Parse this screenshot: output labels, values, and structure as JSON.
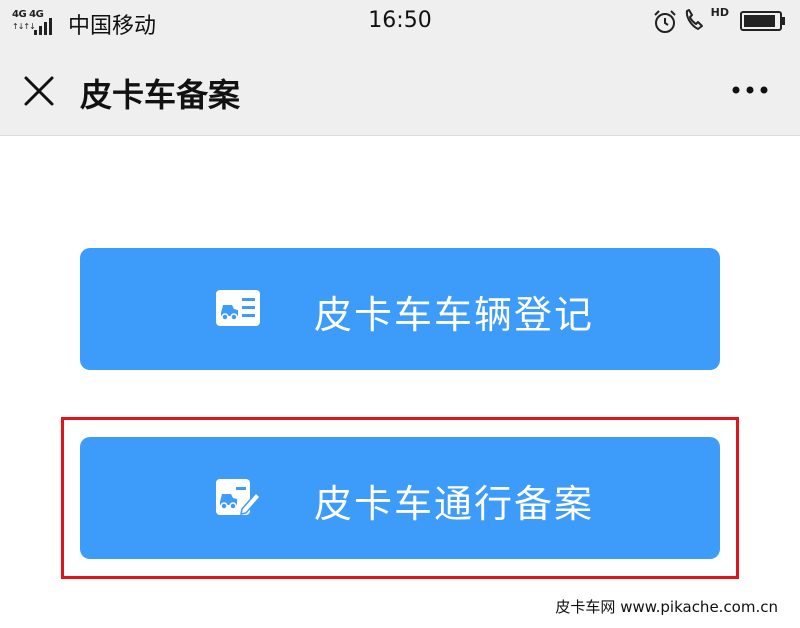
{
  "status_bar": {
    "network_label": "4G 4G",
    "carrier": "中国移动",
    "time": "16:50",
    "hd_label": "HD"
  },
  "nav": {
    "title": "皮卡车备案"
  },
  "buttons": {
    "vehicle_registration": "皮卡车车辆登记",
    "pass_record": "皮卡车通行备案"
  },
  "watermark": "皮卡车网 www.pikache.com.cn",
  "colors": {
    "button_bg": "#3d9bfa",
    "highlight_border": "#e3121b",
    "header_bg": "#efefef"
  },
  "icons": {
    "close": "close-icon",
    "more": "more-dots-icon",
    "register": "vehicle-card-icon",
    "record": "vehicle-card-edit-icon"
  }
}
